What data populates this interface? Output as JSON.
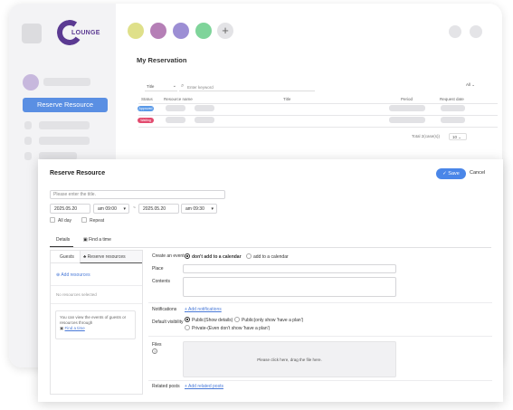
{
  "app": {
    "logo_text": "LOUNGE"
  },
  "sidebar": {
    "reserve_button": "Reserve Resource"
  },
  "header": {
    "color_dots": [
      "#dfe08a",
      "#b57fb6",
      "#9c8ed4",
      "#7fd49a"
    ],
    "add_label": "+"
  },
  "main": {
    "page_title": "My Reservation",
    "filter_select": "Title",
    "search_placeholder": "Enter keyword",
    "all_select": "All",
    "columns": [
      "Status",
      "Resource name",
      "Title",
      "Period",
      "Request date"
    ],
    "rows": [
      {
        "status": "Approved",
        "status_color": "#5b9ae8"
      },
      {
        "status": "Waiting",
        "status_color": "#e24b6f"
      }
    ],
    "total": "Total 2(case(s))",
    "page_size": "10"
  },
  "dialog": {
    "title": "Reserve Resource",
    "save": "Save",
    "cancel": "Cancel",
    "title_placeholder": "Please enter the title.",
    "start_date": "2025.05.20",
    "start_time": "am 09:00",
    "end_date": "2025.05.20",
    "end_time": "am 09:30",
    "range_sep": "~",
    "all_day": "All day",
    "repeat": "Repeat",
    "tabs": [
      "Details",
      "Find a time"
    ],
    "left_tabs": [
      "Guests",
      "Reserve resources"
    ],
    "add_resources": "Add resources",
    "no_resources": "No resources selected",
    "hint_text": "You can view the events of guests or resources through",
    "hint_link": "Find a time",
    "create_event_label": "Create an event",
    "create_event_opt1": "don't add to a calendar",
    "create_event_opt2": "add to a calendar",
    "place_label": "Place",
    "contents_label": "Contents",
    "notifications_label": "Notifications",
    "add_notifications": "Add notifications",
    "default_visibility_label": "Default visibility",
    "vis_opt1": "Public(Show details)",
    "vis_opt2": "Public(only show 'have a plan')",
    "vis_opt3": "Private-(Even don't show 'have a plan')",
    "files_label": "Files",
    "drop_text": "Please click here, drag the file here.",
    "related_label": "Related posts",
    "add_related": "Add related posts"
  }
}
